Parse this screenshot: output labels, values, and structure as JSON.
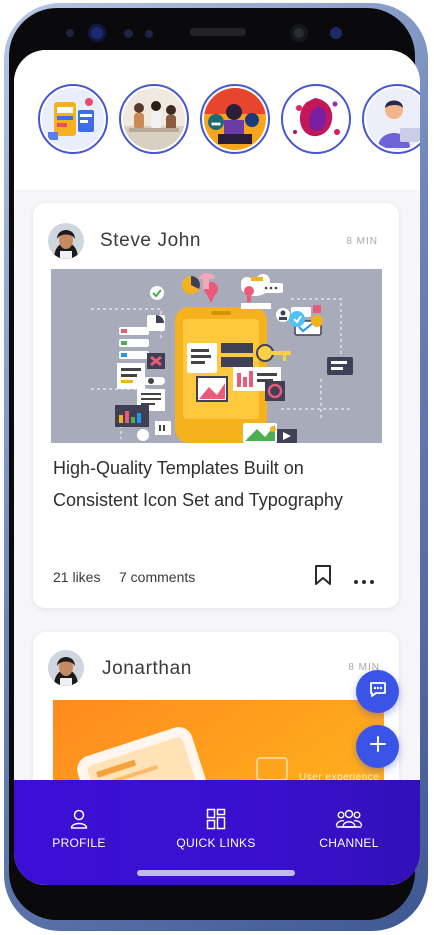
{
  "stories": [
    {
      "name": "story-1"
    },
    {
      "name": "story-2"
    },
    {
      "name": "story-3"
    },
    {
      "name": "story-4"
    },
    {
      "name": "story-5"
    }
  ],
  "posts": [
    {
      "author": "Steve John",
      "time": "8 MIN",
      "title": "High-Quality Templates Built on Consistent Icon Set and Typography",
      "likes": "21 likes",
      "comments": "7 comments"
    },
    {
      "author": "Jonarthan",
      "time": "8 MIN",
      "banner_text": "User experience"
    }
  ],
  "fabs": {
    "chat_icon": "chat-bubble-icon",
    "add_icon": "plus-icon"
  },
  "nav": {
    "profile": "PROFILE",
    "quick_links": "QUICK LINKS",
    "channel": "CHANNEL"
  },
  "colors": {
    "accent": "#3b54e8",
    "nav_bg": "#3b0fd6",
    "story_ring": "#4657cf"
  }
}
